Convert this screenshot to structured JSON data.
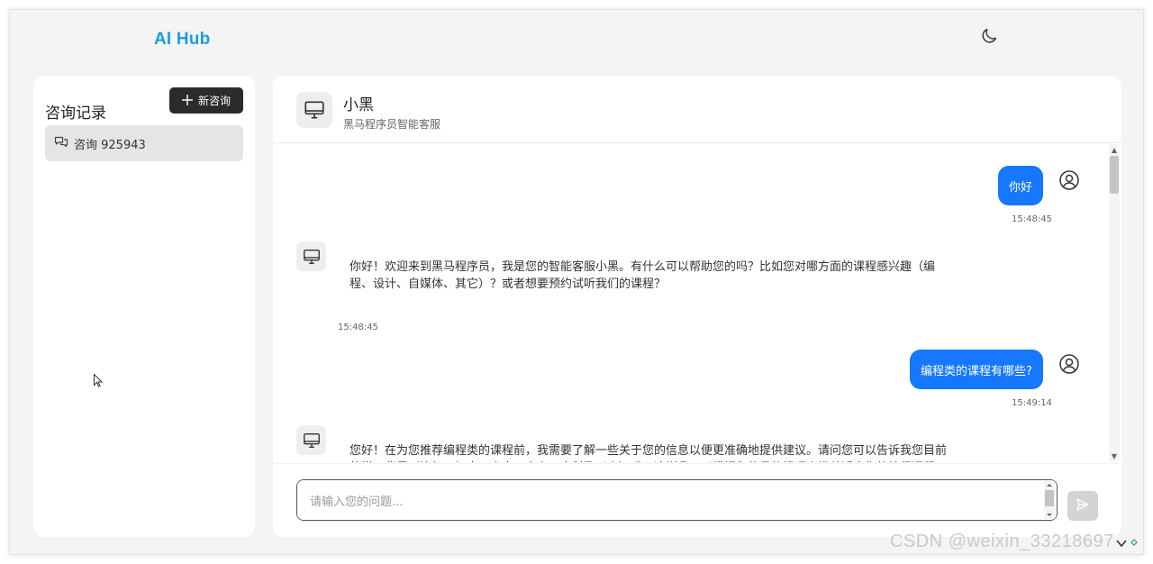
{
  "header": {
    "logo": "AI Hub",
    "theme_toggle_icon": "moon-icon"
  },
  "sidebar": {
    "title": "咨询记录",
    "new_chat_label": "新咨询",
    "history": [
      {
        "label": "咨询 925943",
        "icon": "chat-bubbles-icon",
        "active": true
      }
    ]
  },
  "chat": {
    "bot_name": "小黑",
    "bot_description": "黑马程序员智能客服",
    "messages": [
      {
        "role": "user",
        "text": "你好",
        "time": "15:48:45"
      },
      {
        "role": "bot",
        "text": "你好！欢迎来到黑马程序员，我是您的智能客服小黑。有什么可以帮助您的吗？比如您对哪方面的课程感兴趣（编程、设计、自媒体、其它）？或者想要预约试听我们的课程？",
        "time": "15:48:45"
      },
      {
        "role": "user",
        "text": "编程类的课程有哪些?",
        "time": "15:49:14"
      },
      {
        "role": "bot",
        "text": "您好！在为您推荐编程类的课程前，我需要了解一些关于您的信息以便更准确地提供建议。请问您可以告诉我您目前的学习背景（比如，初中、高中、大专、本科及以上）吗？这样我可以根据您的具体情况来推荐适合您的编程课程。",
        "time": ""
      }
    ],
    "input_placeholder": "请输入您的问题...",
    "send_icon": "send-icon"
  },
  "colors": {
    "logo": "#1a9fd9",
    "user_bubble": "#1677ff",
    "new_chat_button": "#2b2b2b",
    "send_button": "#d4d4d4"
  },
  "watermark": "CSDN @weixin_33218697"
}
